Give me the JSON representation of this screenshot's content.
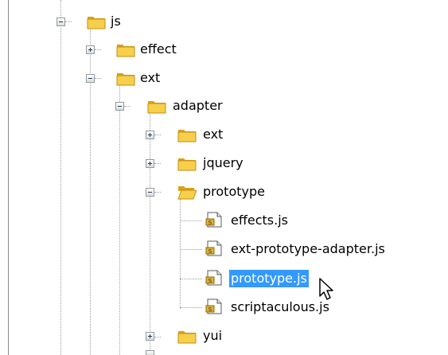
{
  "tree": {
    "items": [
      {
        "label": "js",
        "expanded": true,
        "type": "folder"
      },
      {
        "label": "effect",
        "expanded": false,
        "type": "folder"
      },
      {
        "label": "ext",
        "expanded": true,
        "type": "folder"
      },
      {
        "label": "adapter",
        "expanded": true,
        "type": "folder"
      },
      {
        "label": "ext",
        "expanded": false,
        "type": "folder"
      },
      {
        "label": "jquery",
        "expanded": false,
        "type": "folder"
      },
      {
        "label": "prototype",
        "expanded": true,
        "type": "folder-open"
      },
      {
        "label": "effects.js",
        "type": "js-file"
      },
      {
        "label": "ext-prototype-adapter.js",
        "type": "js-file"
      },
      {
        "label": "prototype.js",
        "type": "js-file",
        "selected": true
      },
      {
        "label": "scriptaculous.js",
        "type": "js-file"
      },
      {
        "label": "yui",
        "expanded": false,
        "type": "folder"
      }
    ]
  },
  "colors": {
    "selection": "#3399ff",
    "folder": "#f5c542"
  }
}
